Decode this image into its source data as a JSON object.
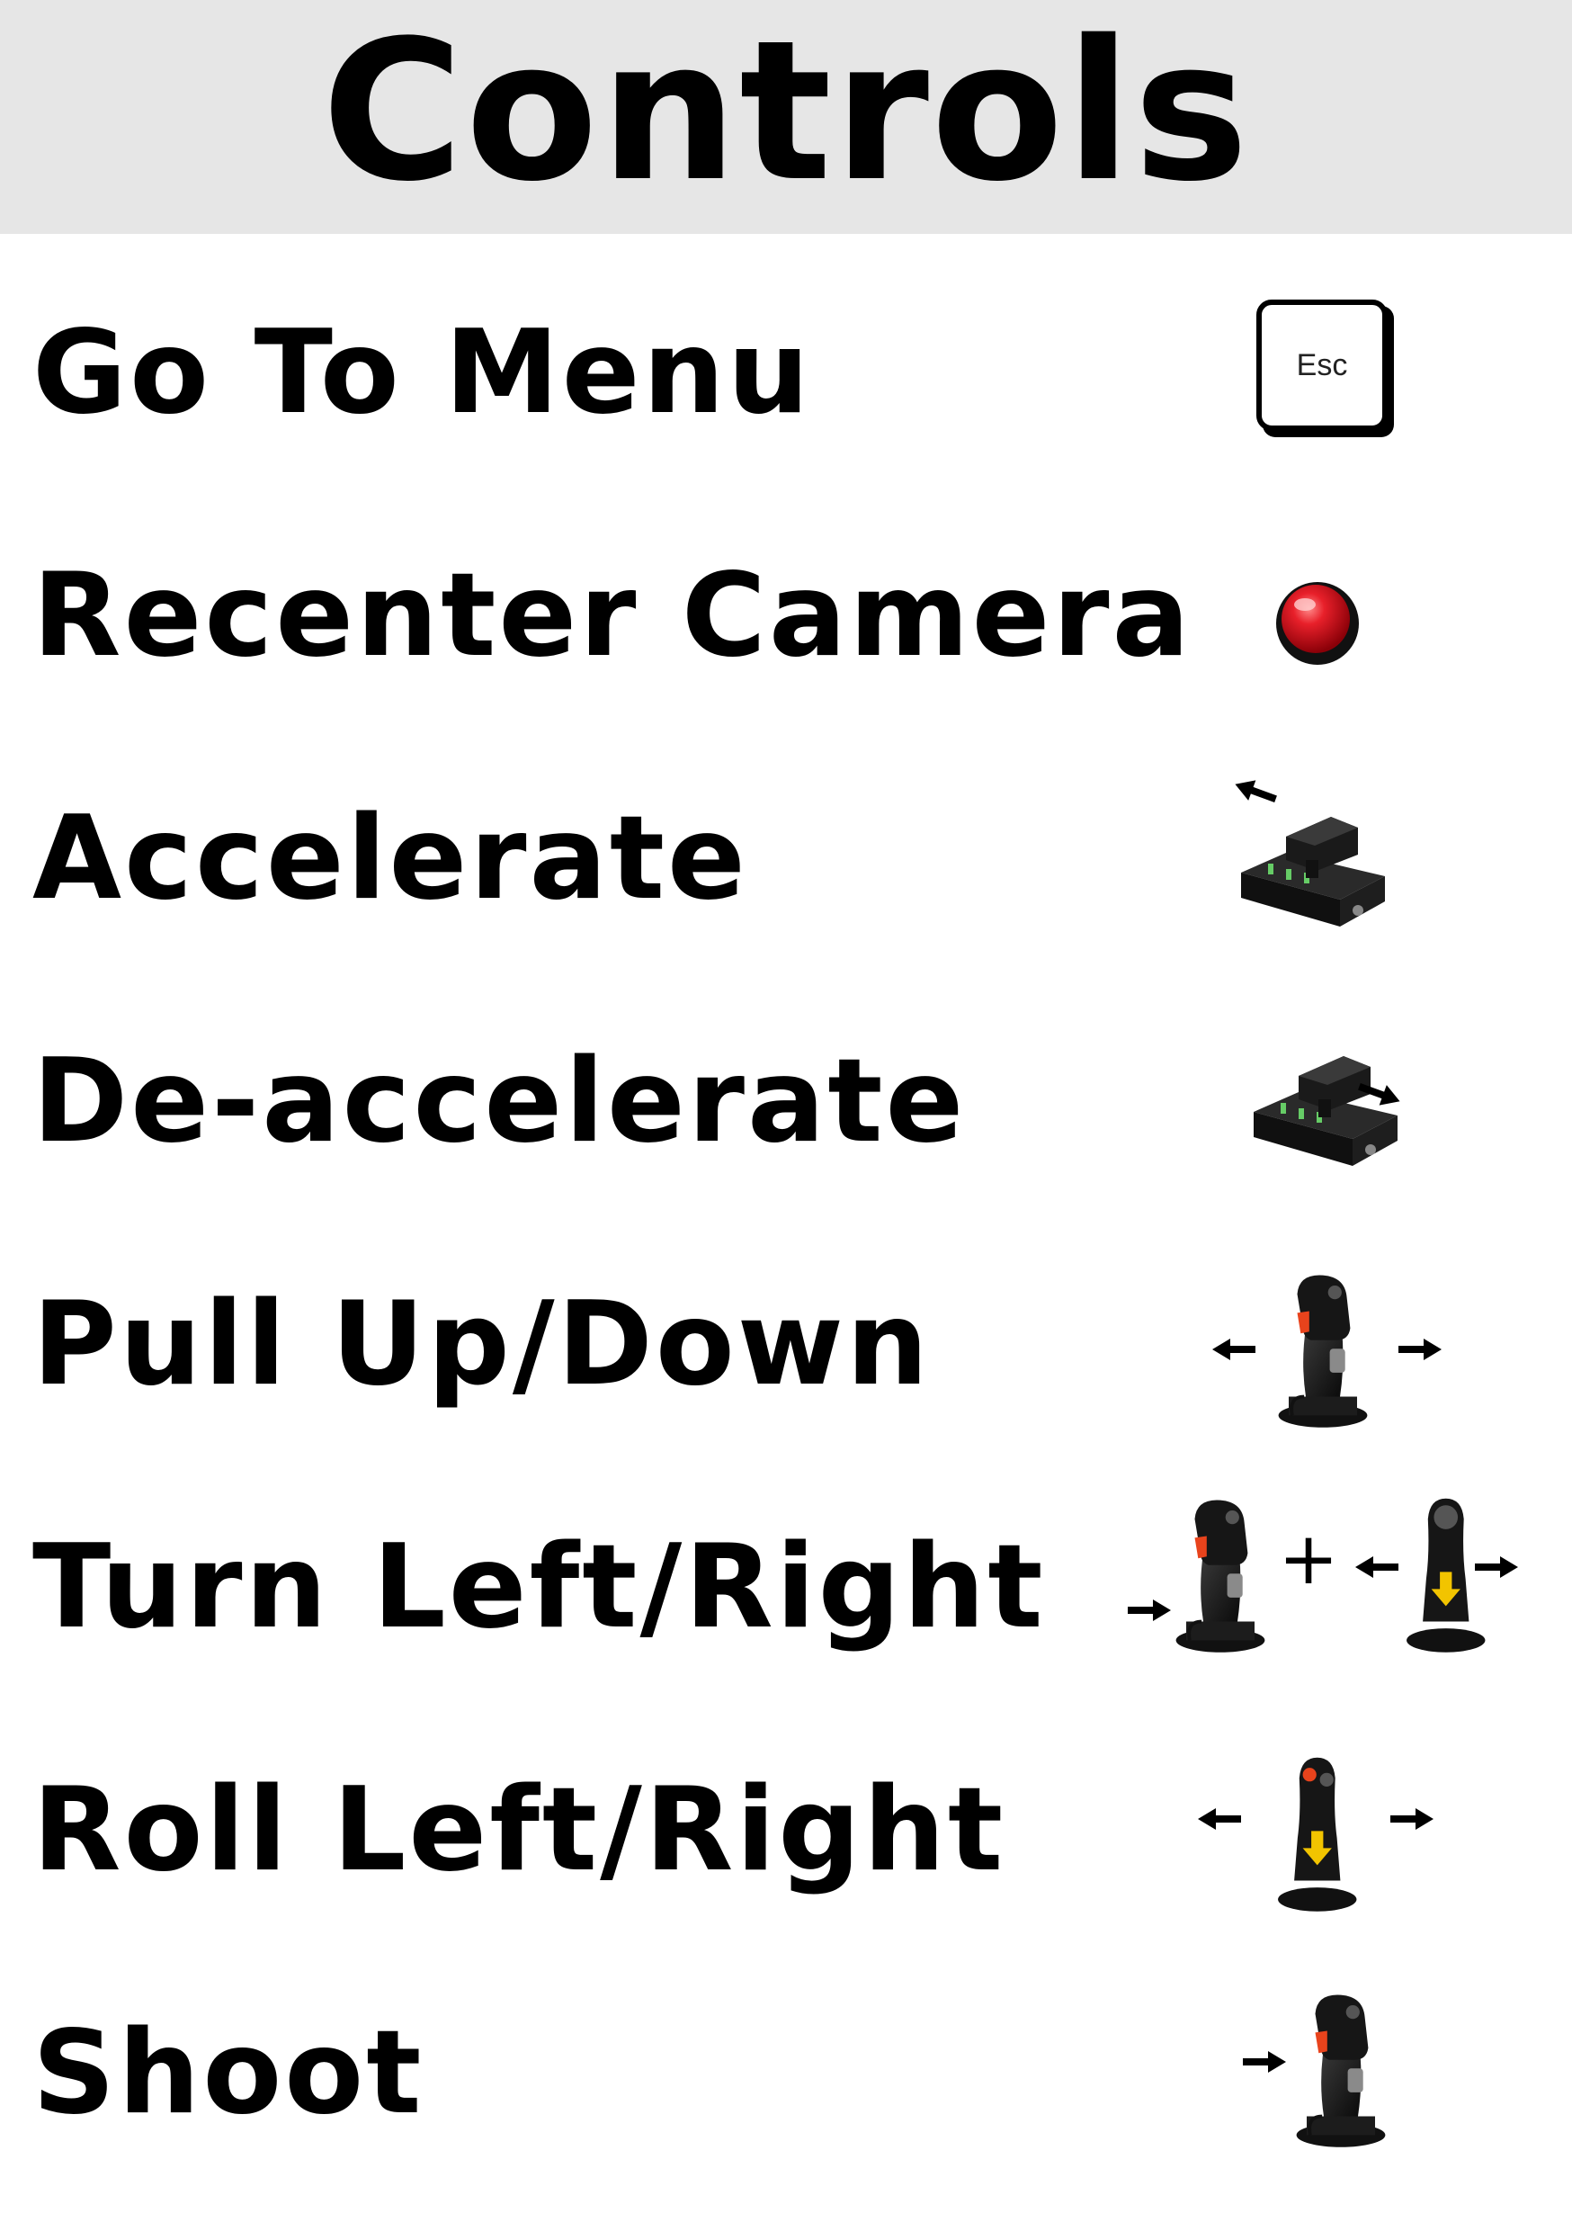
{
  "title": "Controls",
  "controls": [
    {
      "label": "Go To Menu",
      "icon": "esc-key-icon",
      "key_text": "Esc"
    },
    {
      "label": "Recenter Camera",
      "icon": "red-button-icon"
    },
    {
      "label": "Accelerate",
      "icon": "throttle-forward-icon"
    },
    {
      "label": "De-accelerate",
      "icon": "throttle-back-icon"
    },
    {
      "label": "Pull Up/Down",
      "icon": "joystick-tilt-icon"
    },
    {
      "label": "Turn Left/Right",
      "icon": "joystick-twist-and-tilt-icon",
      "plus": "+"
    },
    {
      "label": "Roll Left/Right",
      "icon": "joystick-side-tilt-icon"
    },
    {
      "label": "Shoot",
      "icon": "joystick-trigger-icon"
    }
  ],
  "colors": {
    "header_bg": "#e6e6e6",
    "button_red": "#e8202a",
    "joystick_black": "#141414",
    "accent_orange": "#e8431c",
    "arrow_yellow": "#f2c400"
  }
}
